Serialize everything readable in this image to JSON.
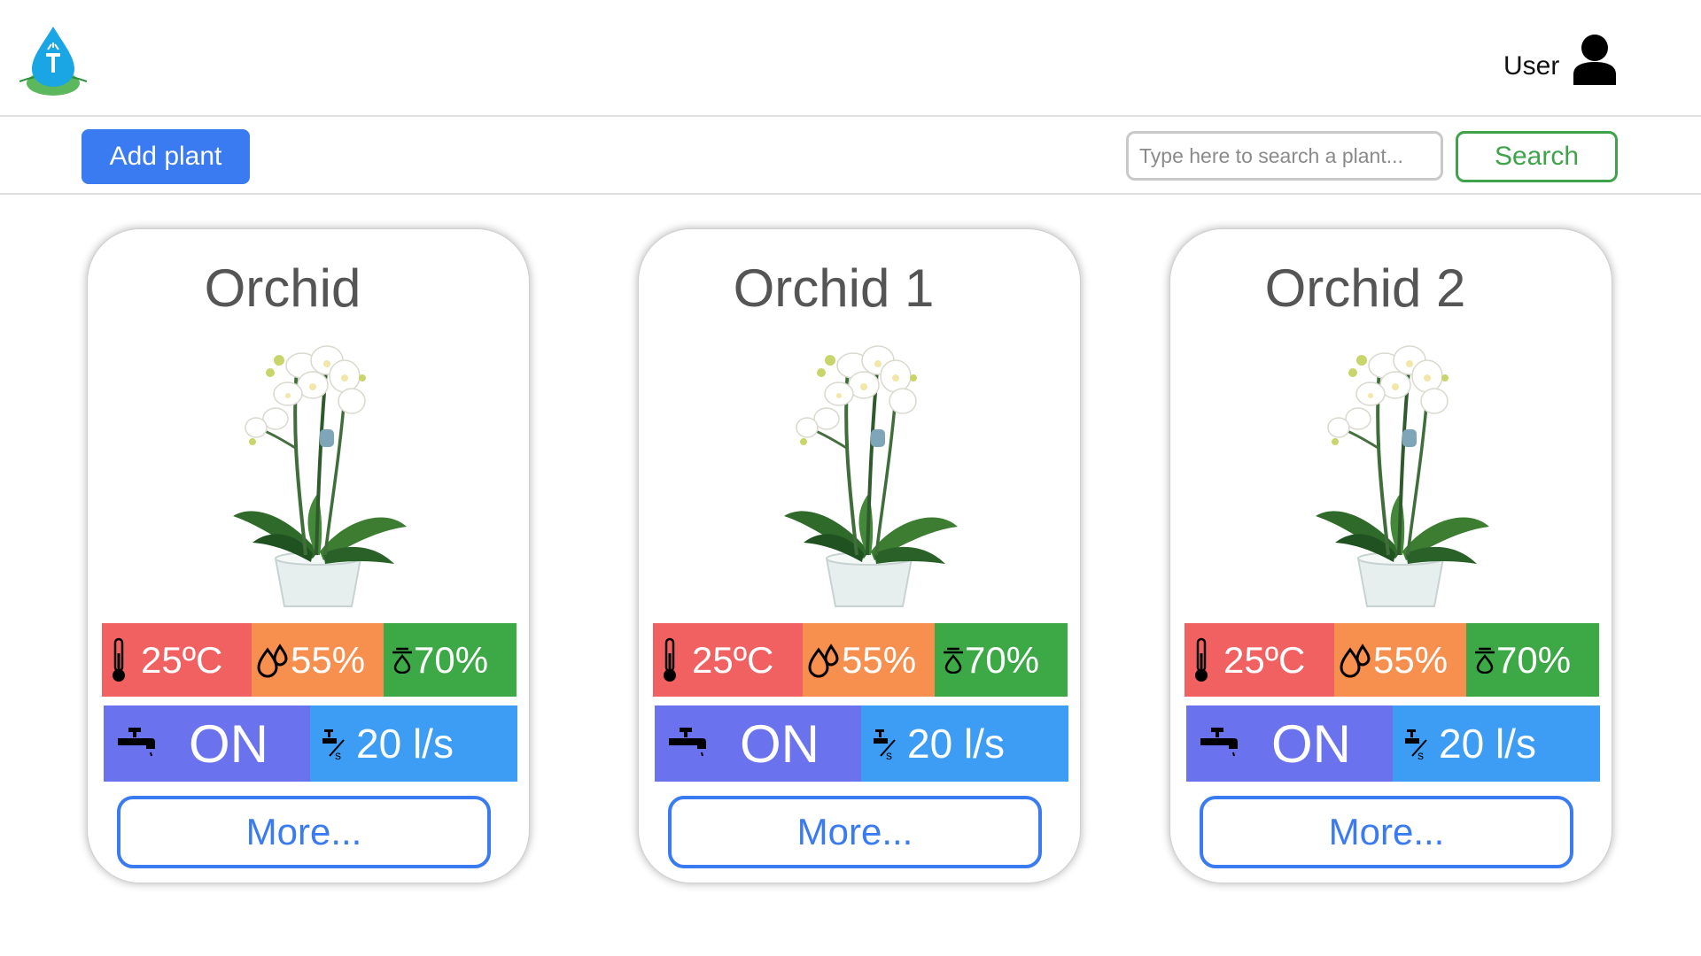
{
  "header": {
    "logo_icon": "water-drop-logo-icon",
    "user_label": "User",
    "user_icon": "user-avatar-icon"
  },
  "toolbar": {
    "add_label": "Add plant",
    "search_placeholder": "Type here to search a plant...",
    "search_value": "",
    "search_label": "Search"
  },
  "colors": {
    "primary": "#3b7bf2",
    "search_green": "#3ea34a",
    "temperature": "#f26161",
    "humidity": "#f7904f",
    "soil": "#3da846",
    "water_status": "#6a72ee",
    "water_flow": "#3d9df5"
  },
  "plants": [
    {
      "name": "Orchid",
      "temperature": "25ºC",
      "humidity": "55%",
      "soil_moisture": "70%",
      "water_status": "ON",
      "flow": "20 l/s",
      "more_label": "More..."
    },
    {
      "name": "Orchid 1",
      "temperature": "25ºC",
      "humidity": "55%",
      "soil_moisture": "70%",
      "water_status": "ON",
      "flow": "20 l/s",
      "more_label": "More..."
    },
    {
      "name": "Orchid 2",
      "temperature": "25ºC",
      "humidity": "55%",
      "soil_moisture": "70%",
      "water_status": "ON",
      "flow": "20 l/s",
      "more_label": "More..."
    }
  ]
}
